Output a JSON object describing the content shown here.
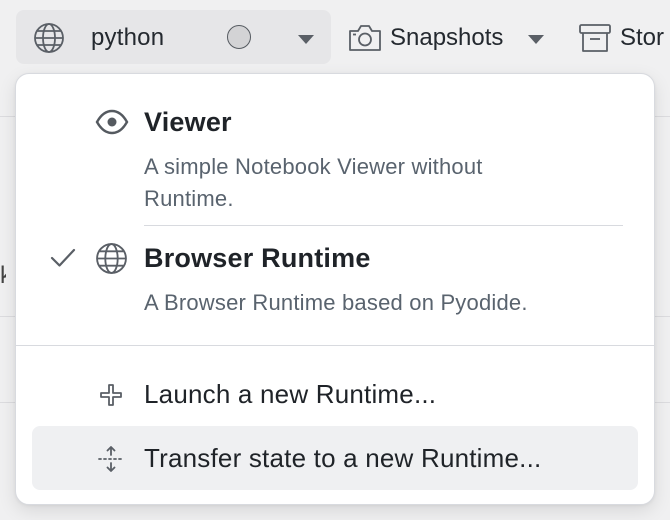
{
  "toolbar": {
    "runtime_name": "python",
    "snapshots_label": "Snapshots",
    "store_label": "Stor"
  },
  "menu": {
    "options": [
      {
        "title": "Viewer",
        "description": "A simple Notebook Viewer without Runtime.",
        "icon": "eye-icon",
        "selected": false
      },
      {
        "title": "Browser Runtime",
        "description": "A Browser Runtime based on Pyodide.",
        "icon": "globe-icon",
        "selected": true
      }
    ],
    "actions": [
      {
        "label": "Launch a new Runtime...",
        "icon": "plus-icon"
      },
      {
        "label": "Transfer state to a new Runtime...",
        "icon": "transfer-icon"
      }
    ]
  },
  "colors": {
    "background": "#f0f0f1",
    "button_bg": "#e6e6e8",
    "menu_bg": "#ffffff",
    "hover_bg": "#eff0f2",
    "text_primary": "#1f2328",
    "text_secondary": "#59636e"
  }
}
